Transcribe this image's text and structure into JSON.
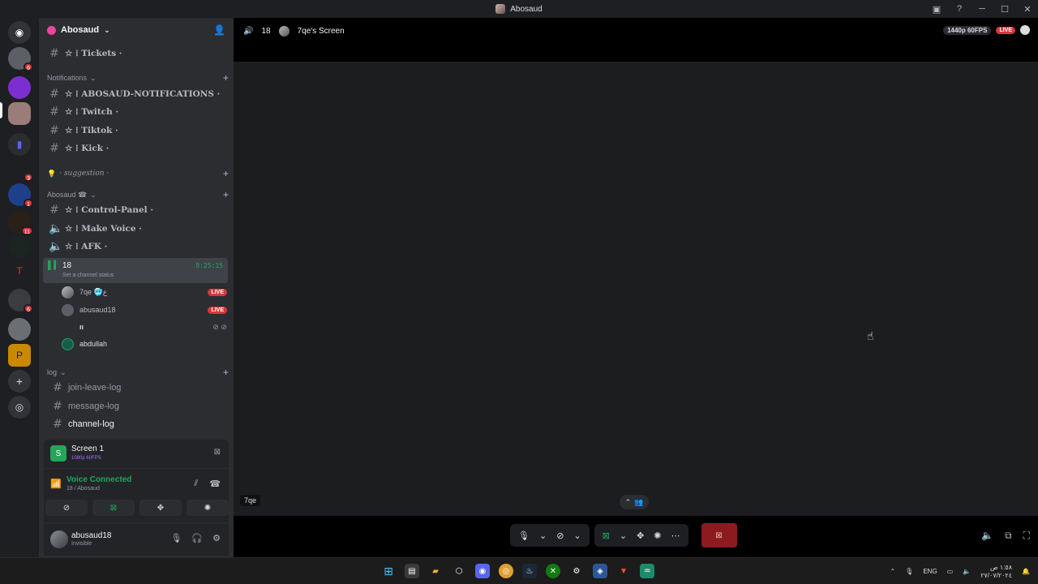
{
  "window": {
    "title": "Abosaud"
  },
  "rail": {
    "badges": [
      "6",
      "3",
      "1",
      "11",
      "6"
    ]
  },
  "guild": {
    "name": "Abosaud"
  },
  "channels": {
    "top": [
      {
        "label": "☆ ⁞ Tickets ·"
      }
    ],
    "notifications_category": "Notifications",
    "notifications": [
      {
        "label": "☆ ⁞ ABOSAUD-NOTIFICATIONS ·"
      },
      {
        "label": "☆ ⁞ Twitch ·"
      },
      {
        "label": "☆ ⁞ Tiktok ·"
      },
      {
        "label": "☆ ⁞ Kick ·"
      }
    ],
    "suggestion": "· suggestion ·",
    "abosaud_category": "Abosaud ☎",
    "abosaud": [
      {
        "label": "☆ ⁞ Control-Panel ·"
      },
      {
        "label": "☆ ⁞ Make Voice ·"
      },
      {
        "label": "☆ ⁞ AFK ·"
      }
    ],
    "active_voice": {
      "name": "18",
      "timer": "8:25:15",
      "status": "Set a channel status"
    },
    "voice_users": [
      {
        "name": "7qe 🥶ع",
        "live": "LIVE"
      },
      {
        "name": "abusaud18",
        "live": "LIVE"
      },
      {
        "name": "ıı"
      },
      {
        "name": "abdullah"
      }
    ],
    "log_category": "log",
    "log": [
      {
        "label": "join-leave-log"
      },
      {
        "label": "message-log"
      },
      {
        "label": "channel-log"
      }
    ]
  },
  "screen_panel": {
    "title": "Screen 1",
    "subtitle": "1080p 60FPS"
  },
  "voice_panel": {
    "status": "Voice Connected",
    "location": "18 / Abosaud"
  },
  "user_panel": {
    "username": "abusaud18",
    "status": "Invisible"
  },
  "stage": {
    "channel": "18",
    "title": "7qe's Screen",
    "quality": "1440p 60FPS",
    "live": "LIVE",
    "streamer": "7qe"
  },
  "taskbar": {
    "lang": "ENG",
    "time": "١:٥٨ ص",
    "date": "٢٧/٠٧/٢٠٢٤"
  },
  "colors": {
    "green": "#23a55a",
    "red": "#da373c",
    "sidebar": "#2b2d31",
    "rail": "#1e1f22"
  }
}
